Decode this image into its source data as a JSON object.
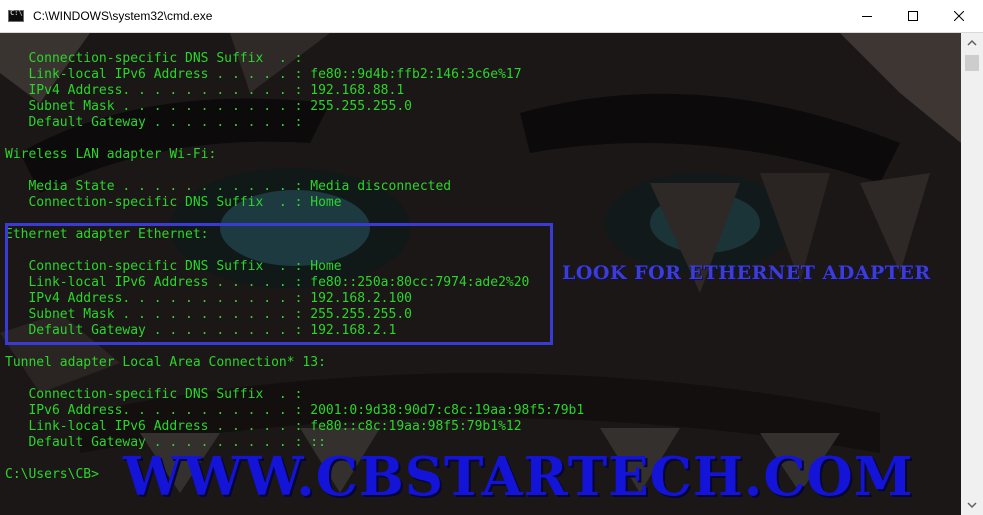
{
  "window": {
    "title": "C:\\WINDOWS\\system32\\cmd.exe",
    "icon": "cmd-icon",
    "buttons": [
      "minimize-icon",
      "maximize-icon",
      "close-icon"
    ]
  },
  "console": {
    "text_color": "#2bd52b",
    "lines": [
      "   Connection-specific DNS Suffix  . :",
      "   Link-local IPv6 Address . . . . . : fe80::9d4b:ffb2:146:3c6e%17",
      "   IPv4 Address. . . . . . . . . . . : 192.168.88.1",
      "   Subnet Mask . . . . . . . . . . . : 255.255.255.0",
      "   Default Gateway . . . . . . . . . :",
      "",
      "Wireless LAN adapter Wi-Fi:",
      "",
      "   Media State . . . . . . . . . . . : Media disconnected",
      "   Connection-specific DNS Suffix  . : Home",
      "",
      "Ethernet adapter Ethernet:",
      "",
      "   Connection-specific DNS Suffix  . : Home",
      "   Link-local IPv6 Address . . . . . : fe80::250a:80cc:7974:ade2%20",
      "   IPv4 Address. . . . . . . . . . . : 192.168.2.100",
      "   Subnet Mask . . . . . . . . . . . : 255.255.255.0",
      "   Default Gateway . . . . . . . . . : 192.168.2.1",
      "",
      "Tunnel adapter Local Area Connection* 13:",
      "",
      "   Connection-specific DNS Suffix  . :",
      "   IPv6 Address. . . . . . . . . . . : 2001:0:9d38:90d7:c8c:19aa:98f5:79b1",
      "   Link-local IPv6 Address . . . . . : fe80::c8c:19aa:98f5:79b1%12",
      "   Default Gateway . . . . . . . . . : ::",
      "",
      "C:\\Users\\CB>"
    ]
  },
  "overlay": {
    "annotation": "LOOK FOR ETHERNET ADAPTER",
    "watermark": "WWW.CBSTARTECH.COM",
    "accent_color": "#3a3ad6"
  }
}
